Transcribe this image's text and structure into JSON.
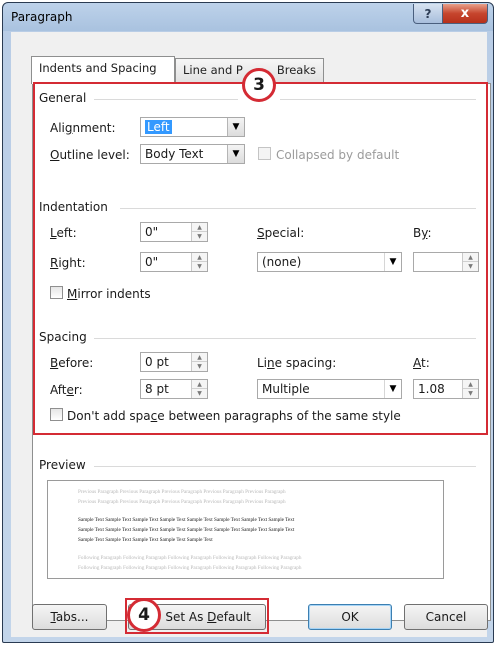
{
  "window": {
    "title": "Paragraph",
    "help_glyph": "?",
    "close_glyph": "x"
  },
  "tabs": [
    {
      "label": "Indents and Spacing",
      "active": true
    },
    {
      "label_left": "Line and P",
      "label_right": "Breaks",
      "active": false
    }
  ],
  "markers": {
    "step3": "3",
    "step4": "4"
  },
  "general": {
    "heading": "General",
    "alignment_label_pre": "Ali",
    "alignment_label_u": "g",
    "alignment_label_post": "nment:",
    "alignment_value": "Left",
    "outline_label_u": "O",
    "outline_label_post": "utline level:",
    "outline_value": "Body Text",
    "collapsed_label": "Collapsed by default"
  },
  "indentation": {
    "heading": "Indentation",
    "left_label_u": "L",
    "left_label_post": "eft:",
    "left_value": "0\"",
    "right_label_u": "R",
    "right_label_post": "ight:",
    "right_value": "0\"",
    "special_label_u": "S",
    "special_label_post": "pecial:",
    "special_value": "(none)",
    "by_label_pre": "B",
    "by_label_u": "y",
    "by_label_post": ":",
    "by_value": "",
    "mirror_label_pre": "",
    "mirror_label_u": "M",
    "mirror_label_post": "irror indents"
  },
  "spacing": {
    "heading": "Spacing",
    "before_label_u": "B",
    "before_label_post": "efore:",
    "before_value": "0 pt",
    "after_label_pre": "Aft",
    "after_label_u": "e",
    "after_label_post": "r:",
    "after_value": "8 pt",
    "line_label_pre": "Li",
    "line_label_u": "n",
    "line_label_post": "e spacing:",
    "line_value": "Multiple",
    "at_label_u": "A",
    "at_label_post": "t:",
    "at_value": "1.08",
    "dont_add_pre": "Don't add spa",
    "dont_add_u": "c",
    "dont_add_post": "e between paragraphs of the same style"
  },
  "preview": {
    "heading": "Preview",
    "prev_para_1": "Previous Paragraph Previous Paragraph Previous Paragraph Previous Paragraph Previous Paragraph",
    "prev_para_2": "Previous Paragraph Previous Paragraph Previous Paragraph Previous Paragraph Previous Paragraph",
    "sample_1": "Sample Text Sample Text Sample Text Sample Text Sample Text Sample Text Sample Text Sample Text",
    "sample_2": "Sample Text Sample Text Sample Text Sample Text Sample Text Sample Text Sample Text Sample Text",
    "sample_3": "Sample Text Sample Text Sample Text Sample Text Sample Text",
    "follow_1": "Following Paragraph Following Paragraph Following Paragraph Following Paragraph Following Paragraph",
    "follow_2": "Following Paragraph Following Paragraph Following Paragraph Following Paragraph Following Paragraph"
  },
  "buttons": {
    "tabs_u": "T",
    "tabs_post": "abs...",
    "default_pre": "Set As ",
    "default_u": "D",
    "default_post": "efault",
    "ok": "OK",
    "cancel": "Cancel"
  },
  "colors": {
    "highlight_red": "#d42b34",
    "selection_blue": "#3399ff"
  }
}
